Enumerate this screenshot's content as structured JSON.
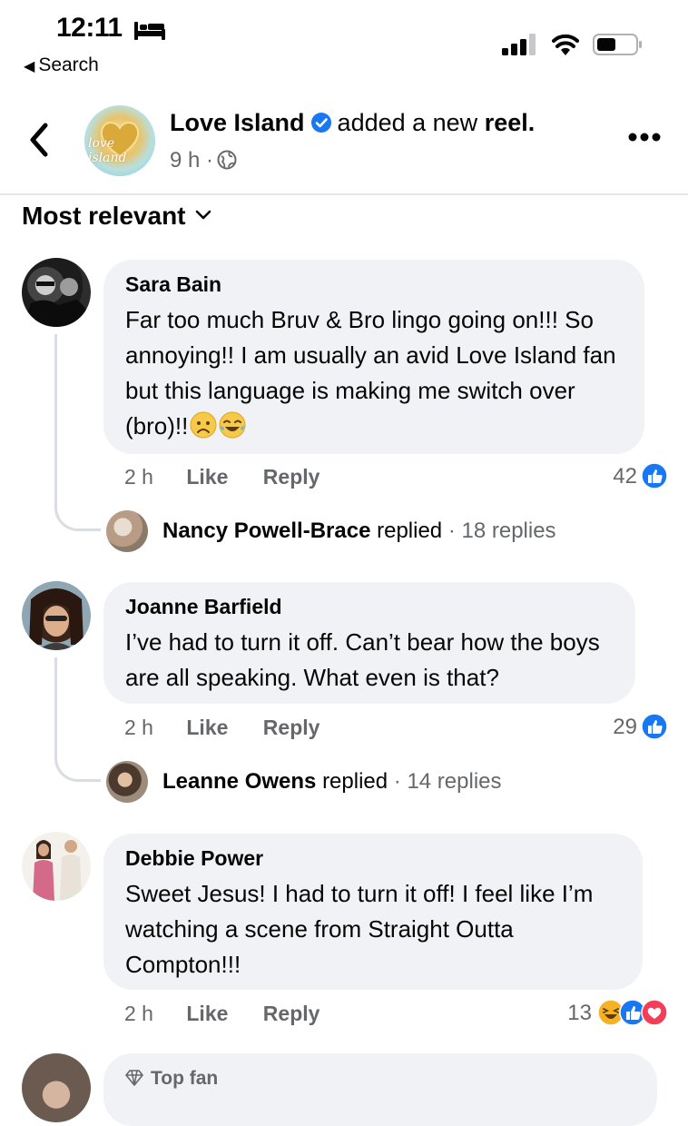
{
  "status_bar": {
    "time": "12:11",
    "back_label": "Search",
    "back_glyph": "◀"
  },
  "post": {
    "page_name": "Love Island",
    "avatar_text": "love island",
    "action_text": "added a new",
    "action_object": "reel.",
    "age": "9 h",
    "separator": "·",
    "verified_color": "#1877f2"
  },
  "sort": {
    "label": "Most relevant"
  },
  "comments": [
    {
      "author": "Sara Bain",
      "text": "Far too much Bruv & Bro lingo going on!!! So annoying!! I am usually an avid Love Island fan but this language is making me switch over (bro)!!",
      "emojis": [
        "worried-face",
        "tears-of-joy-face"
      ],
      "time": "2 h",
      "like_label": "Like",
      "reply_label": "Reply",
      "reaction_count": "42",
      "reactions": [
        "like"
      ],
      "replies": {
        "name": "Nancy Powell-Brace",
        "verb": "replied",
        "count": "18 replies"
      }
    },
    {
      "author": "Joanne Barfield",
      "text": "I’ve had to turn it off. Can’t bear how the boys are all speaking. What even is that?",
      "time": "2 h",
      "like_label": "Like",
      "reply_label": "Reply",
      "reaction_count": "29",
      "reactions": [
        "like"
      ],
      "replies": {
        "name": "Leanne Owens",
        "verb": "replied",
        "count": "14 replies"
      }
    },
    {
      "author": "Debbie Power",
      "text": "Sweet Jesus! I had to turn it off! I feel like I’m watching a scene from Straight Outta Compton!!!",
      "time": "2 h",
      "like_label": "Like",
      "reply_label": "Reply",
      "reaction_count": "13",
      "reactions": [
        "haha",
        "like",
        "love"
      ]
    },
    {
      "badge": "Top fan"
    }
  ],
  "colors": {
    "like_blue": "#1877f2",
    "love_red": "#f33e58",
    "haha_yellow": "#f7b125",
    "bubble_gray": "#f0f2f5",
    "meta_gray": "#65676b"
  }
}
